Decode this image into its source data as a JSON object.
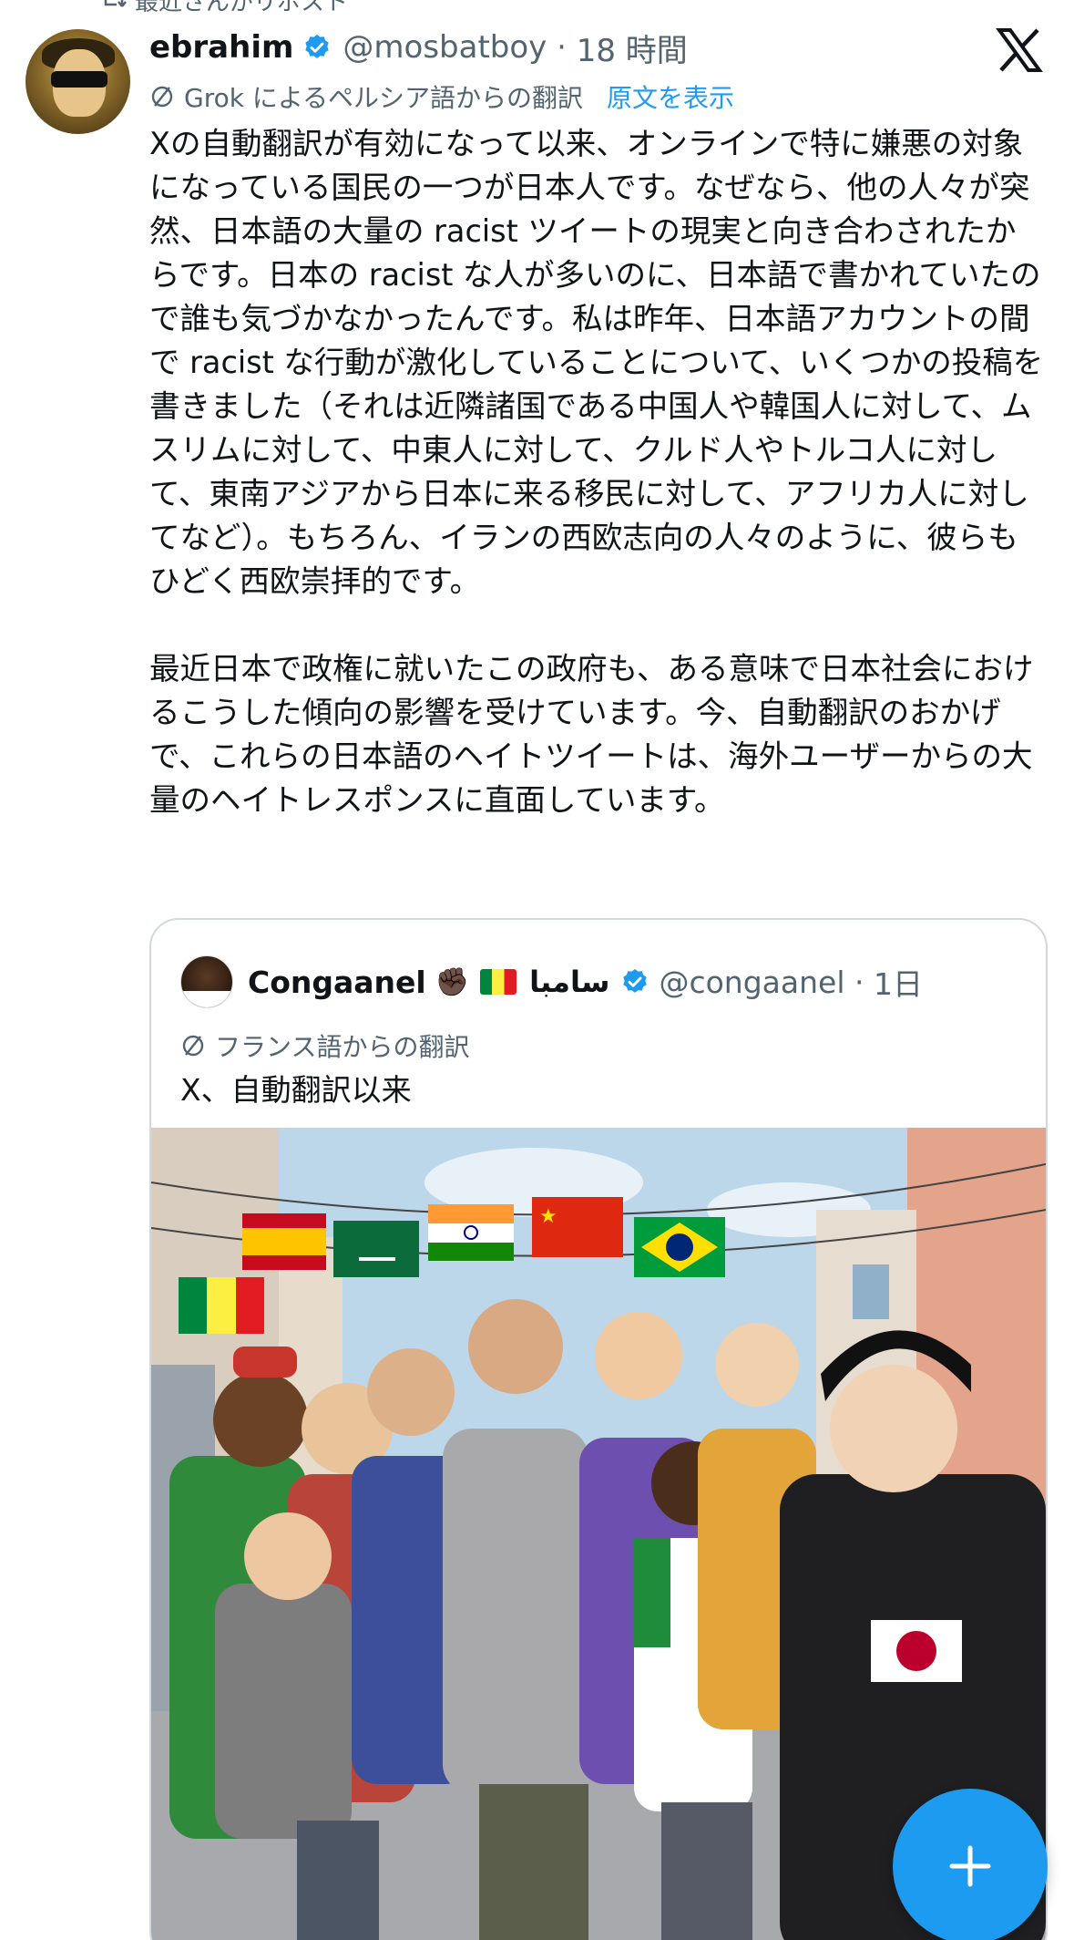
{
  "repost": {
    "label": "最近さんがリポスト"
  },
  "post": {
    "name": "ebrahim",
    "handle": "@mosbatboy",
    "time": "18 時間",
    "translation_note": "Grok によるペルシア語からの翻訳",
    "show_original": "原文を表示",
    "text": "Xの自動翻訳が有効になって以来、オンラインで特に嫌悪の対象になっている国民の一つが日本人です。なぜなら、他の人々が突然、日本語の大量の racist ツイートの現実と向き合わされたからです。日本の racist な人が多いのに、日本語で書かれていたので誰も気づかなかったんです。私は昨年、日本語アカウントの間で racist な行動が激化していることについて、いくつかの投稿を書きました（それは近隣諸国である中国人や韓国人に対して、ムスリムに対して、中東人に対して、クルド人やトルコ人に対して、東南アジアから日本に来る移民に対して、アフリカ人に対してなど）。もちろん、イランの西欧志向の人々のように、彼らもひどく西欧崇拝的です。\n\n最近日本で政権に就いたこの政府も、ある意味で日本社会におけるこうした傾向の影響を受けています。今、自動翻訳のおかげで、これらの日本語のヘイトツイートは、海外ユーザーからの大量のヘイトレスポンスに直面しています。"
  },
  "quoted": {
    "name": "Congaanel",
    "emoji": "✊🏿",
    "arabic": "سامبا",
    "handle": "@congaanel",
    "time": "1日",
    "translation_note": "フランス語からの翻訳",
    "text": "X、自動翻訳以来",
    "image_alt": "cartoon-crowd-with-flags",
    "flags": [
      "senegal",
      "spain",
      "saudi-arabia",
      "india",
      "china",
      "brazil",
      "nigeria",
      "japan"
    ]
  },
  "colors": {
    "accent": "#1d9bf0",
    "muted": "#536471",
    "text": "#0f1419",
    "border": "#cfd9de"
  },
  "icons": [
    "repost-icon",
    "verified-badge-icon",
    "x-logo-icon",
    "translate-icon",
    "plus-icon"
  ]
}
